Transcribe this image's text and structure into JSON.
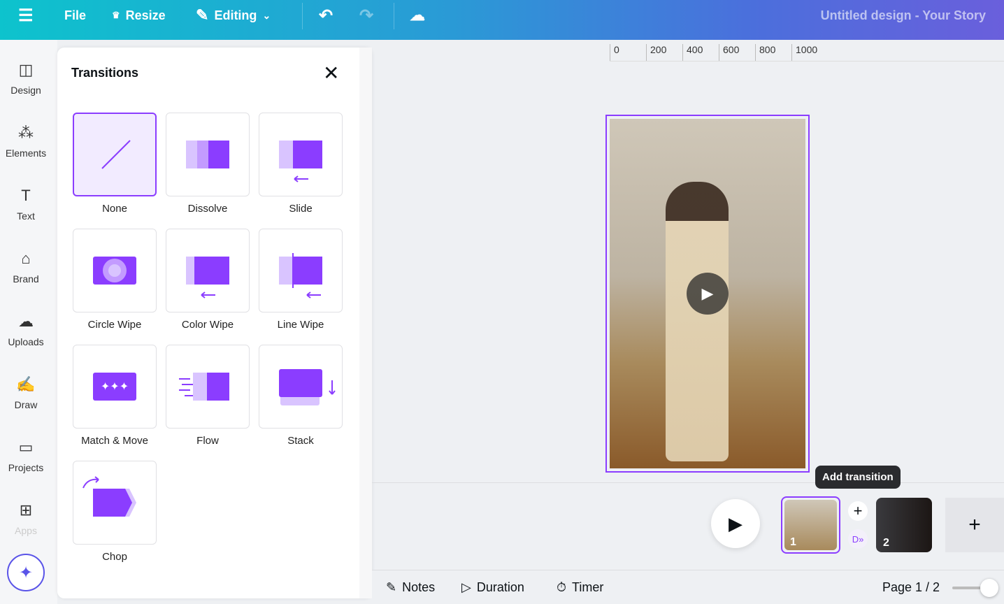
{
  "topbar": {
    "file": "File",
    "resize": "Resize",
    "editing": "Editing",
    "title": "Untitled design - Your Story"
  },
  "sidebar": {
    "items": [
      {
        "label": "Design",
        "icon": "layout-icon"
      },
      {
        "label": "Elements",
        "icon": "shapes-icon"
      },
      {
        "label": "Text",
        "icon": "text-icon"
      },
      {
        "label": "Brand",
        "icon": "brand-icon"
      },
      {
        "label": "Uploads",
        "icon": "cloud-upload-icon"
      },
      {
        "label": "Draw",
        "icon": "pen-icon"
      },
      {
        "label": "Projects",
        "icon": "folder-icon"
      },
      {
        "label": "Apps",
        "icon": "apps-icon"
      }
    ]
  },
  "panel": {
    "title": "Transitions",
    "items": [
      "None",
      "Dissolve",
      "Slide",
      "Circle Wipe",
      "Color Wipe",
      "Line Wipe",
      "Match & Move",
      "Flow",
      "Stack",
      "Chop"
    ],
    "selected": "None"
  },
  "ruler": [
    "0",
    "200",
    "400",
    "600",
    "800",
    "1000"
  ],
  "timeline": {
    "tooltip": "Add transition",
    "pages": [
      "1",
      "2"
    ]
  },
  "footer": {
    "notes": "Notes",
    "duration": "Duration",
    "timer": "Timer",
    "page": "Page 1 / 2",
    "zoom_level": 0.75
  },
  "colors": {
    "accent": "#8b3dff",
    "light": "#d9c4ff"
  }
}
